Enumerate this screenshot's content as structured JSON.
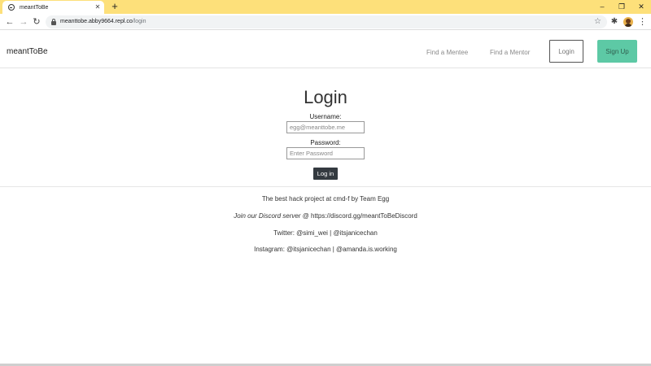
{
  "browser": {
    "tab_title": "meantToBe",
    "new_tab": "+",
    "url_host": "meanttobe.abby9664.repl.co",
    "url_path": "/login",
    "controls": {
      "minimize": "–",
      "maximize": "❐",
      "close": "✕"
    }
  },
  "nav": {
    "brand": "meantToBe",
    "links": [
      "Find a Mentee",
      "Find a Mentor"
    ],
    "login": "Login",
    "signup": "Sign Up"
  },
  "form": {
    "title": "Login",
    "username_label": "Username:",
    "username_placeholder": "egg@meanttobe.me",
    "password_label": "Password:",
    "password_placeholder": "Enter Password",
    "submit": "Log in"
  },
  "footer": {
    "line1": "The best hack project at cmd-f by Team Egg",
    "line2_italic": "Join our Discord server",
    "line2_rest": " @ https://discord.gg/meantToBeDiscord",
    "line3": "Twitter: @simi_wei | @itsjanicechan",
    "line4": "Instagram: @itsjanicechan | @amanda.is.working"
  },
  "icons": [
    "globe-icon",
    "close-icon",
    "back-icon",
    "forward-icon",
    "reload-icon",
    "lock-icon",
    "star-icon",
    "extensions-icon",
    "avatar",
    "menu-icon"
  ],
  "colors": {
    "tabbar": "#fde07a",
    "signup": "#5dc9a5",
    "submit": "#343a40"
  }
}
